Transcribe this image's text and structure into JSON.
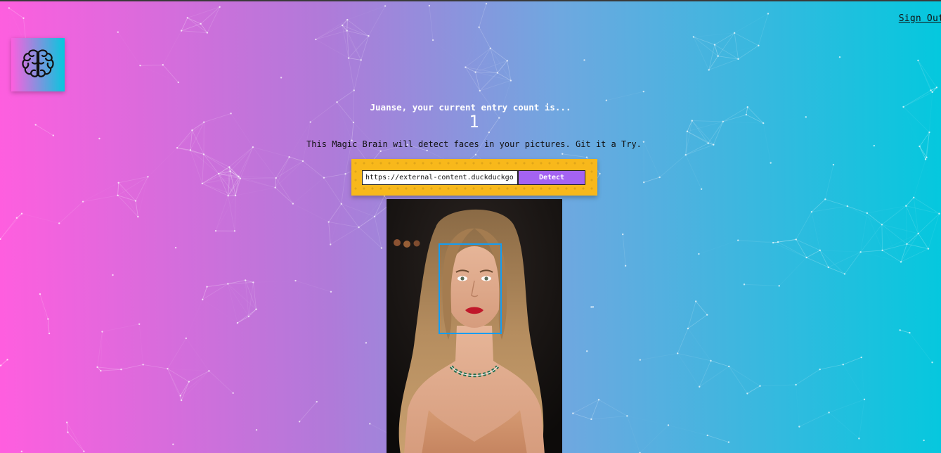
{
  "nav": {
    "sign_out_label": "Sign Out"
  },
  "logo": {
    "icon": "brain-icon"
  },
  "rank": {
    "greeting": "Juanse, your current entry count is...",
    "count": "1"
  },
  "intro": {
    "text": "This Magic Brain will detect faces in your pictures. Git it a Try."
  },
  "form": {
    "url_value": "https://external-content.duckduckgo",
    "detect_label": "Detect"
  },
  "colors": {
    "gradient_left": "#ff5edf",
    "gradient_right": "#04c8de",
    "form_background": "#f8b81b",
    "button": "#a463f2",
    "face_box": "#149df2"
  }
}
